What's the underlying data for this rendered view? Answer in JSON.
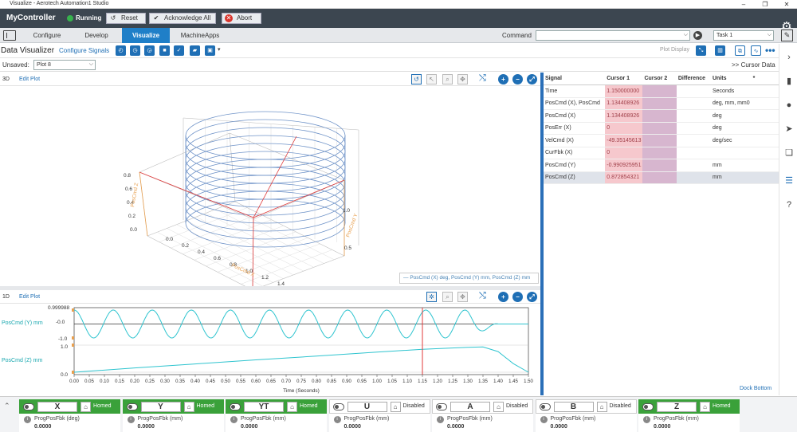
{
  "window": {
    "title": "Visualize - Aerotech Automation1 Studio"
  },
  "controller": {
    "name": "MyController",
    "status": "Running",
    "reset_label": "Reset",
    "ack_label": "Acknowledge All",
    "abort_label": "Abort"
  },
  "nav": {
    "tabs": [
      "Configure",
      "Develop",
      "Visualize",
      "MachineApps"
    ],
    "active": "Visualize",
    "command_label": "Command",
    "task_value": "Task 1"
  },
  "dv": {
    "title": "Data Visualizer",
    "configure_label": "Configure Signals",
    "plot_display_label": "Plot Display"
  },
  "plotbar": {
    "unsaved_label": "Unsaved:",
    "plot_select": "Plot 8",
    "cursor_data_label": "Cursor Data"
  },
  "pane3d": {
    "mode": "3D",
    "edit_label": "Edit Plot",
    "legend": "PosCmd (X) deg, PosCmd (Y) mm, PosCmd (Z) mm",
    "x_ticks": [
      "0.0",
      "0.2",
      "0.4",
      "0.6",
      "0.8",
      "1.0",
      "1.2",
      "1.4",
      "1.6",
      "1.8"
    ],
    "z_ticks": [
      "0.0",
      "0.2",
      "0.4",
      "0.6",
      "0.8"
    ],
    "y_ticks": [
      "0.5",
      "1.0"
    ],
    "x_axis_label": "PosCmd X",
    "z_axis_label": "PosCmd Z",
    "y_axis_label": "PosCmd Y"
  },
  "pane1d": {
    "mode": "1D",
    "edit_label": "Edit Plot",
    "ymax_label": "0.999988",
    "series": [
      {
        "name": "PosCmd (Y) mm",
        "ticks": [
          "-0.0",
          "-1.0"
        ]
      },
      {
        "name": "PosCmd (Z) mm",
        "ticks": [
          "1.0",
          "0.0"
        ]
      }
    ],
    "x_ticks": [
      "0.00",
      "0.05",
      "0.10",
      "0.15",
      "0.20",
      "0.25",
      "0.30",
      "0.35",
      "0.40",
      "0.45",
      "0.50",
      "0.55",
      "0.60",
      "0.65",
      "0.70",
      "0.75",
      "0.80",
      "0.85",
      "0.90",
      "0.95",
      "1.00",
      "1.05",
      "1.10",
      "1.15",
      "1.20",
      "1.25",
      "1.30",
      "1.35",
      "1.40",
      "1.45",
      "1.50"
    ],
    "xlabel": "Time (Seconds)",
    "cursor1_x": 1.15
  },
  "chart_data": {
    "type": "line",
    "x_range": [
      0,
      1.5
    ],
    "xlabel": "Time (Seconds)",
    "series": [
      {
        "name": "PosCmd (Y) mm",
        "description": "sinusoid amplitude ~1.0, ~11.5 cycles, settling to 0 after 1.3 s",
        "ylim": [
          -1.0,
          1.0
        ]
      },
      {
        "name": "PosCmd (Z) mm",
        "x": [
          0,
          0.2,
          0.4,
          0.6,
          0.8,
          1.0,
          1.15,
          1.3,
          1.35,
          1.4,
          1.45,
          1.5
        ],
        "values": [
          0,
          0.15,
          0.29,
          0.43,
          0.56,
          0.7,
          0.8,
          0.87,
          0.88,
          0.72,
          0.3,
          0.0
        ],
        "ylim": [
          0,
          1.0
        ]
      }
    ]
  },
  "cursor_table": {
    "headers": [
      "Signal",
      "Cursor 1",
      "Cursor 2",
      "Difference",
      "Units",
      "*"
    ],
    "rows": [
      {
        "signal": "Time",
        "c1": "1.150000000",
        "units": "Seconds"
      },
      {
        "signal": "PosCmd (X), PosCmd",
        "c1": "1.134408926",
        "units": "deg, mm, mm0"
      },
      {
        "signal": "PosCmd (X)",
        "c1": "1.134408926",
        "units": "deg"
      },
      {
        "signal": "PosErr (X)",
        "c1": "0",
        "units": "deg"
      },
      {
        "signal": "VelCmd (X)",
        "c1": "-49.35145613",
        "units": "deg/sec"
      },
      {
        "signal": "CurFbk (X)",
        "c1": "0",
        "units": ""
      },
      {
        "signal": "PosCmd (Y)",
        "c1": "-0.990925951",
        "units": "mm"
      },
      {
        "signal": "PosCmd (Z)",
        "c1": "0.872854321",
        "units": "mm"
      }
    ],
    "dock_label": "Dock Bottom"
  },
  "axes": [
    {
      "name": "X",
      "status": "Homed",
      "homed": true,
      "sub": "ProgPosFbk (deg)",
      "value": "0.0000"
    },
    {
      "name": "Y",
      "status": "Homed",
      "homed": true,
      "sub": "ProgPosFbk (mm)",
      "value": "0.0000"
    },
    {
      "name": "YT",
      "status": "Homed",
      "homed": true,
      "sub": "ProgPosFbk (mm)",
      "value": "0.0000"
    },
    {
      "name": "U",
      "status": "Disabled",
      "homed": false,
      "sub": "ProgPosFbk (mm)",
      "value": "0.0000"
    },
    {
      "name": "A",
      "status": "Disabled",
      "homed": false,
      "sub": "ProgPosFbk (mm)",
      "value": "0.0000"
    },
    {
      "name": "B",
      "status": "Disabled",
      "homed": false,
      "sub": "ProgPosFbk (mm)",
      "value": "0.0000"
    },
    {
      "name": "Z",
      "status": "Homed",
      "homed": true,
      "sub": "ProgPosFbk (mm)",
      "value": "0.0000"
    }
  ]
}
